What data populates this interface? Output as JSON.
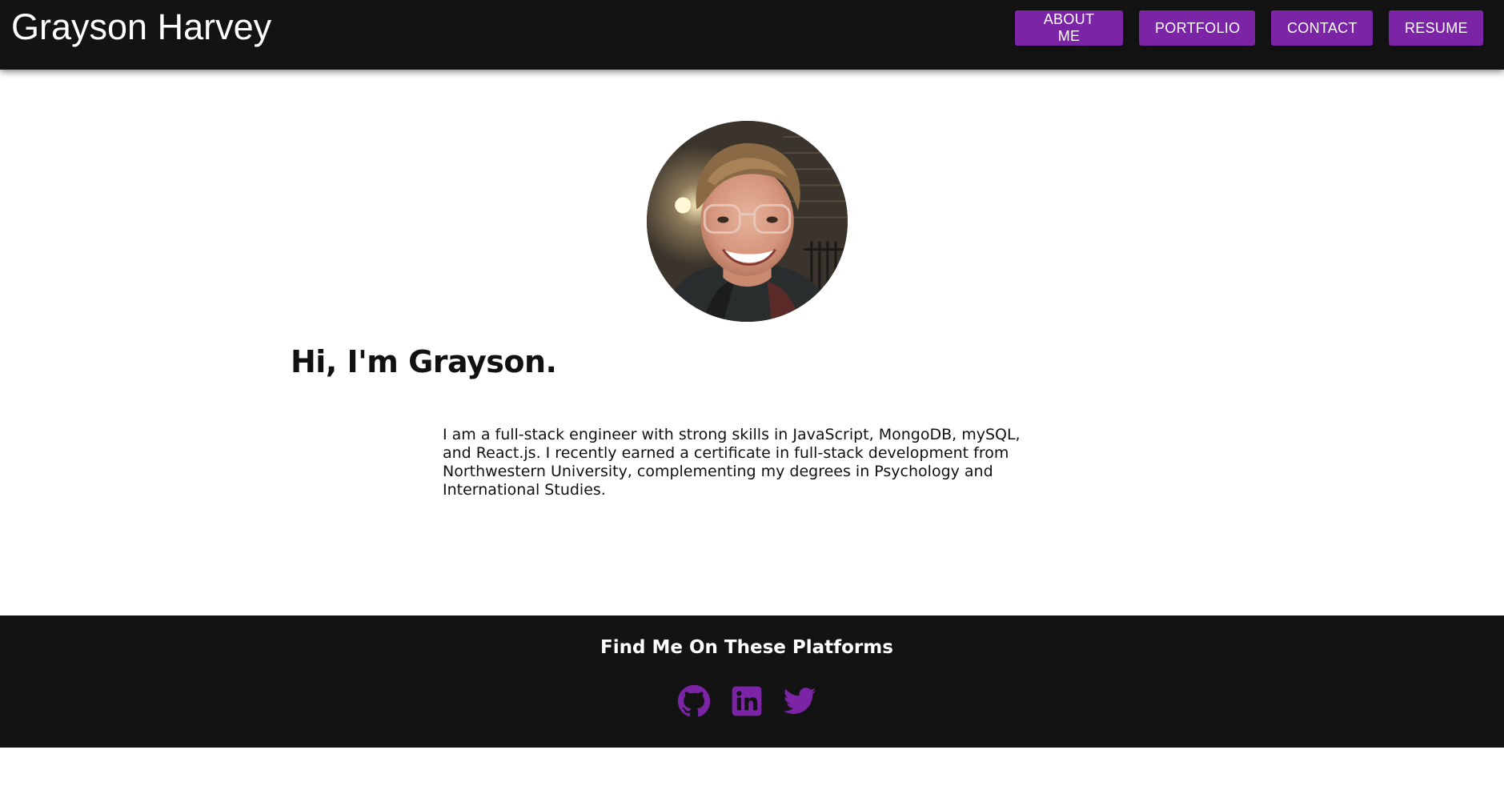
{
  "header": {
    "brand": "Grayson Harvey",
    "nav": [
      {
        "label": "ABOUT ME"
      },
      {
        "label": "PORTFOLIO"
      },
      {
        "label": "CONTACT"
      },
      {
        "label": "RESUME"
      }
    ]
  },
  "main": {
    "avatar_icon": "profile-photo",
    "greeting": "Hi, I'm Grayson.",
    "bio": "I am a full-stack engineer with strong skills in JavaScript, MongoDB, mySQL, and React.js. I recently earned a certificate in full-stack development from Northwestern University, complementing my degrees in Psychology and International Studies."
  },
  "footer": {
    "title": "Find Me On These Platforms",
    "social": [
      {
        "icon": "github-icon"
      },
      {
        "icon": "linkedin-icon"
      },
      {
        "icon": "twitter-icon"
      }
    ]
  },
  "colors": {
    "header_bg": "#131313",
    "accent": "#7b24a6",
    "footer_bg": "#131313",
    "text": "#111111"
  }
}
